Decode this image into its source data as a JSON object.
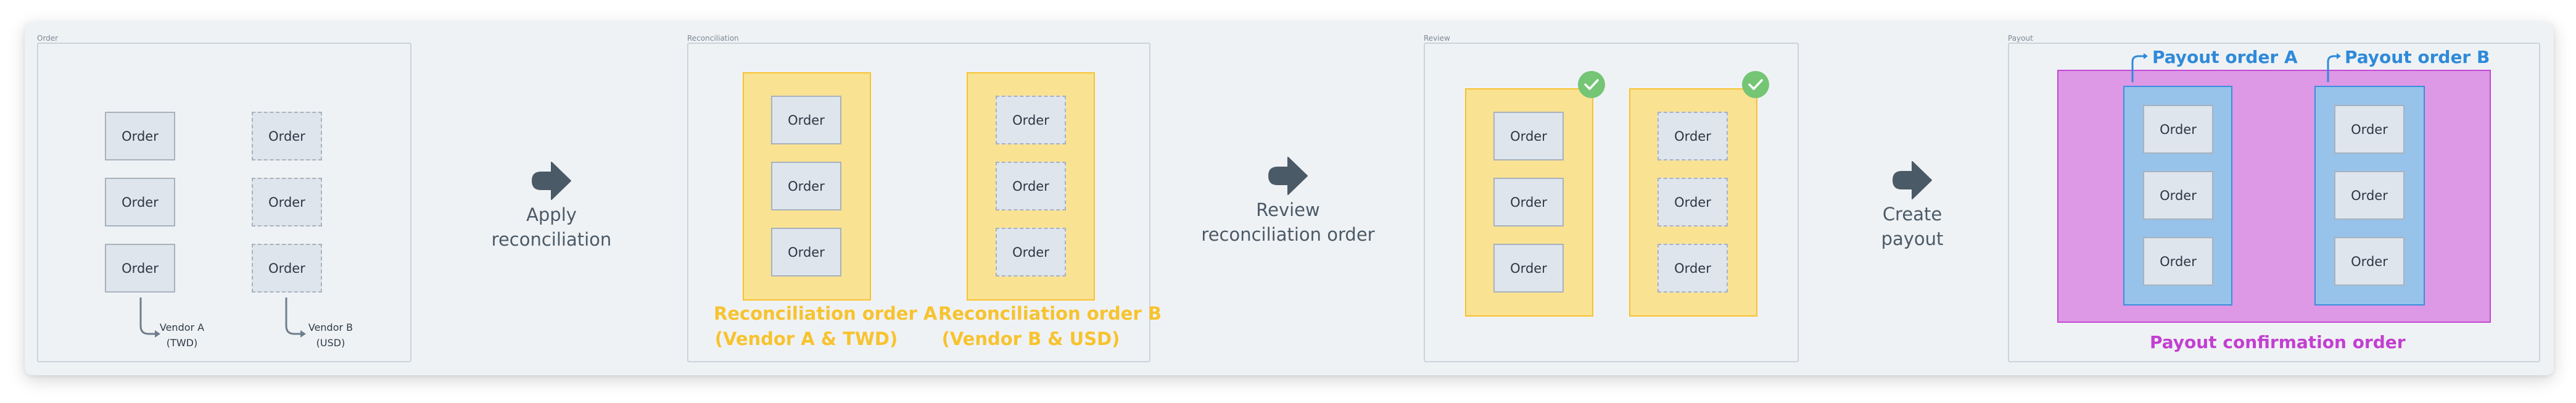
{
  "colors": {
    "card_bg": "#eff2f5",
    "frame_border": "#cbd3db",
    "order_fill": "#dfe5ed",
    "order_border": "#a7b2bd",
    "step_arrow": "#4b5a67",
    "reconciliation_yellow": "#f7c32e",
    "review_check": "#74c574",
    "payout_blue": "#2f8ad9",
    "confirmation_purple": "#c23fd1"
  },
  "frames": {
    "order": "Order",
    "reconciliation": "Reconciliation",
    "review": "Review",
    "payout": "Payout"
  },
  "order_label": "Order",
  "order_stage": {
    "vendor_a": {
      "line1": "Vendor A",
      "line2": "(TWD)"
    },
    "vendor_b": {
      "line1": "Vendor B",
      "line2": "(USD)"
    }
  },
  "steps": [
    {
      "icon": "arrow-right-icon",
      "line1": "Apply",
      "line2": "reconciliation"
    },
    {
      "icon": "arrow-right-icon",
      "line1": "Review",
      "line2": "reconciliation order"
    },
    {
      "icon": "arrow-right-icon",
      "line1": "Create",
      "line2": "payout"
    }
  ],
  "reconciliation": {
    "order_a": {
      "line1": "Reconciliation order A",
      "line2": "(Vendor A & TWD)"
    },
    "order_b": {
      "line1": "Reconciliation order B",
      "line2": "(Vendor B & USD)"
    }
  },
  "review": {
    "status_icon": "check-circle-icon",
    "order_a_status": "approved",
    "order_b_status": "approved"
  },
  "payout": {
    "order_a": "Payout order  A",
    "order_b": "Payout order B",
    "confirmation": "Payout confirmation order"
  }
}
